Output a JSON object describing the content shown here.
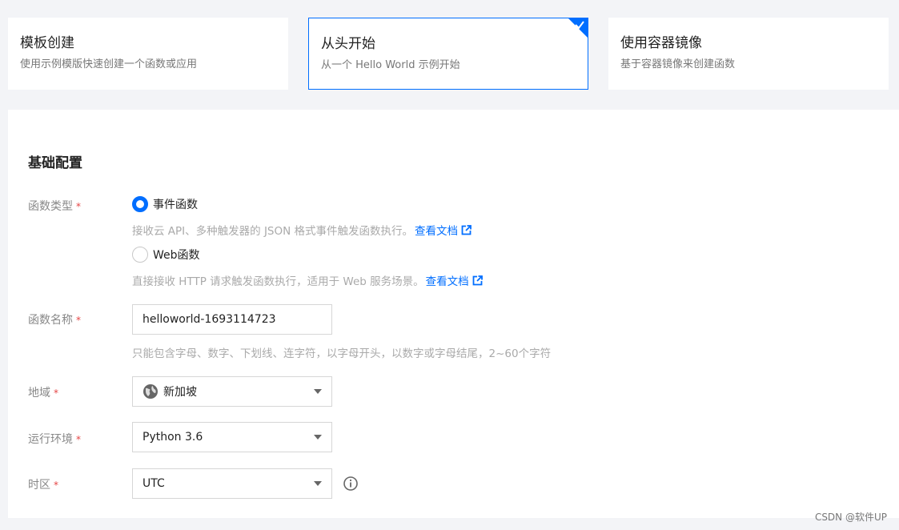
{
  "cards": [
    {
      "title": "模板创建",
      "desc": "使用示例模版快速创建一个函数或应用",
      "selected": false
    },
    {
      "title": "从头开始",
      "desc": "从一个 Hello World 示例开始",
      "selected": true
    },
    {
      "title": "使用容器镜像",
      "desc": "基于容器镜像来创建函数",
      "selected": false
    }
  ],
  "section": {
    "title": "基础配置"
  },
  "required_mark": "*",
  "function_type": {
    "label": "函数类型",
    "options": [
      {
        "label": "事件函数",
        "hint": "接收云 API、多种触发器的 JSON 格式事件触发函数执行。",
        "link": "查看文档",
        "checked": true
      },
      {
        "label": "Web函数",
        "hint": "直接接收 HTTP 请求触发函数执行，适用于 Web 服务场景。",
        "link": "查看文档",
        "checked": false
      }
    ]
  },
  "function_name": {
    "label": "函数名称",
    "value": "helloworld-1693114723",
    "hint": "只能包含字母、数字、下划线、连字符，以字母开头，以数字或字母结尾，2~60个字符"
  },
  "region": {
    "label": "地域",
    "value": "新加坡",
    "icon": "globe-icon"
  },
  "runtime": {
    "label": "运行环境",
    "value": "Python 3.6"
  },
  "timezone": {
    "label": "时区",
    "value": "UTC",
    "info_icon": "info-icon"
  },
  "watermark": "CSDN @软件UP",
  "colors": {
    "accent": "#006eff",
    "required": "#e54545"
  }
}
